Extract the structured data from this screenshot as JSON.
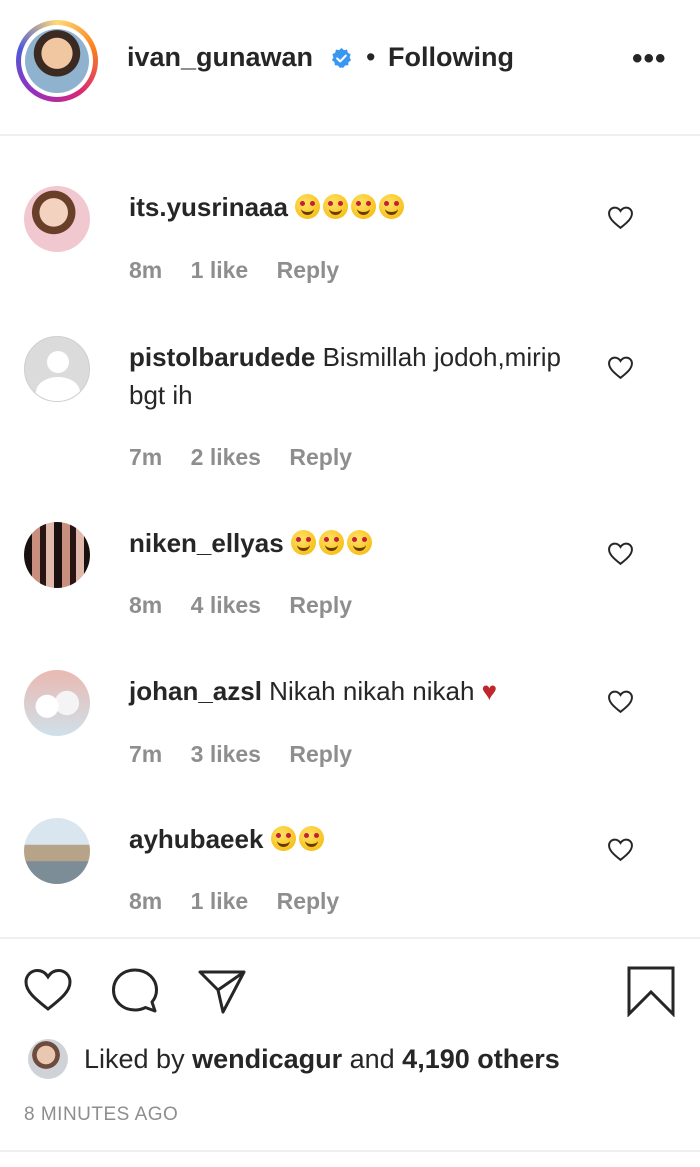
{
  "header": {
    "username": "ivan_gunawan",
    "separator": "•",
    "follow_status": "Following",
    "more_label": "•••"
  },
  "comments": [
    {
      "username": "its.yusrinaaa",
      "text": "",
      "emoji": "smiling-face-with-heart-eyes",
      "emoji_count": 4,
      "time": "8m",
      "likes": "1 like",
      "reply": "Reply"
    },
    {
      "username": "pistolbarudede",
      "text": "Bismillah jodoh,mirip bgt ih",
      "time": "7m",
      "likes": "2 likes",
      "reply": "Reply"
    },
    {
      "username": "niken_ellyas",
      "text": "",
      "emoji": "smiling-face-with-heart-eyes",
      "emoji_count": 3,
      "time": "8m",
      "likes": "4 likes",
      "reply": "Reply"
    },
    {
      "username": "johan_azsl",
      "text": "Nikah nikah nikah",
      "emoji": "red-heart",
      "time": "7m",
      "likes": "3 likes",
      "reply": "Reply"
    },
    {
      "username": "ayhubaeek",
      "text": "",
      "emoji": "smiling-face-with-heart-eyes",
      "emoji_count": 2,
      "time": "8m",
      "likes": "1 like",
      "reply": "Reply"
    }
  ],
  "actions": {
    "like_icon": "heart-icon",
    "comment_icon": "comment-icon",
    "share_icon": "paper-plane-icon",
    "save_icon": "bookmark-icon"
  },
  "likes_summary": {
    "prefix": "Liked by ",
    "user": "wendicagur",
    "middle": " and ",
    "others": "4,190 others"
  },
  "timestamp": "8 MINUTES AGO",
  "colors": {
    "text": "#262626",
    "secondary": "#8e8e8e",
    "verified": "#3897f0",
    "divider": "#efefef"
  }
}
